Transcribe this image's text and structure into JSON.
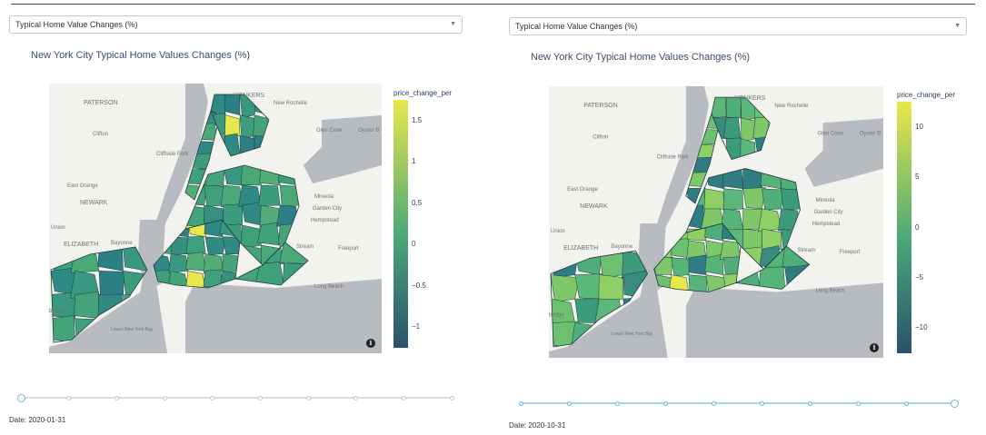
{
  "left": {
    "dropdown_value": "Typical Home Value Changes (%)",
    "title": "New York City Typical Home Values Changes (%)",
    "colorbar_title": "price_change_per",
    "colorbar_ticks": [
      "1.5",
      "1",
      "0.5",
      "0",
      "−0.5",
      "−1"
    ],
    "date": "Date: 2020-01-31",
    "slider_position": 0
  },
  "right": {
    "dropdown_value": "Typical Home Value Changes (%)",
    "title": "New York City Typical Home Values Changes (%)",
    "colorbar_title": "price_change_per",
    "colorbar_ticks": [
      "10",
      "5",
      "0",
      "−5",
      "−10"
    ],
    "date": "Date: 2020-10-31",
    "slider_position": 1
  },
  "map_labels": [
    "YONKERS",
    "New Rochelle",
    "PATERSON",
    "Glen Cove",
    "Oyster B",
    "Clifton",
    "Cliffside Park",
    "East Orange",
    "NEWARK",
    "Mineola",
    "Garden City",
    "Hempstead",
    "Union",
    "ELIZABETH",
    "Bayonne",
    "Stream",
    "Freeport",
    "Long Beach",
    "bridge",
    "Lower New York Bay"
  ],
  "info_icon": "i",
  "colors": {
    "scale_top": "#e8e84a",
    "scale_mid": "#4aa878",
    "scale_bottom": "#29516a",
    "land": "#f2f2ef",
    "water": "#b8bcc0",
    "slider_active": "#9fd8ee"
  },
  "icons": [
    "chevron-down-icon",
    "info-icon"
  ]
}
